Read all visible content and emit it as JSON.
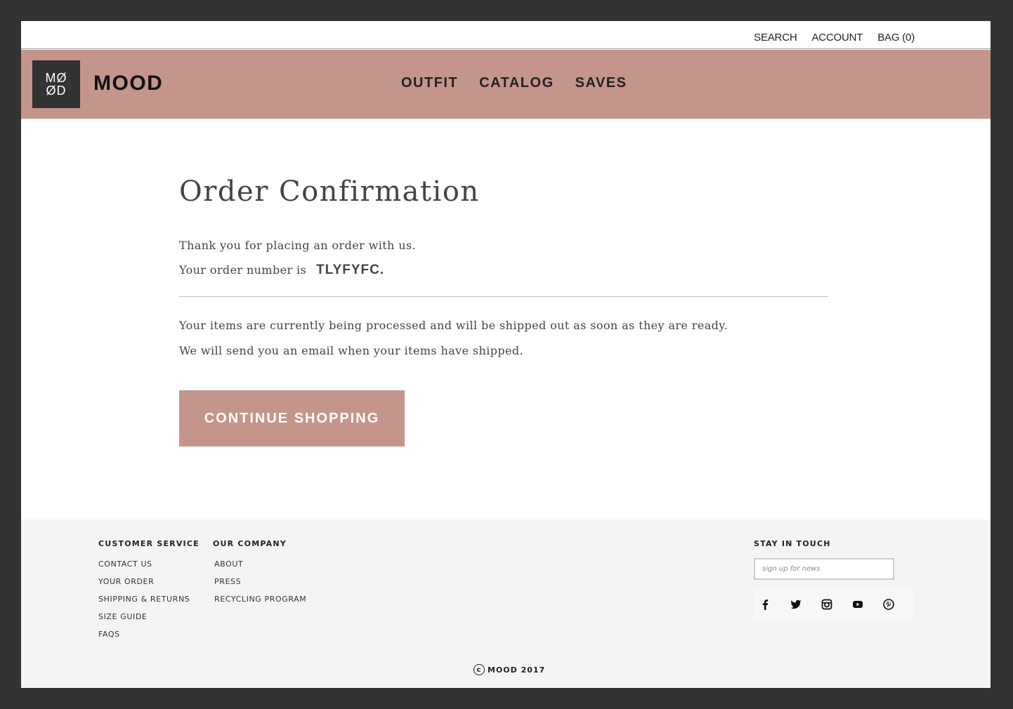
{
  "utility_nav": {
    "search": "SEARCH",
    "account": "ACCOUNT",
    "bag": "BAG (0)"
  },
  "brand": {
    "logo_line1": "MØ",
    "logo_line2": "ØD",
    "name": "MOOD"
  },
  "main_nav": {
    "outfit": "OUTFIT",
    "catalog": "CATALOG",
    "saves": "SAVES"
  },
  "confirmation": {
    "title": "Order Confirmation",
    "thanks": "Thank you for placing an order with us.",
    "order_number_label": "Your order number is",
    "order_number": "TLYFYFC.",
    "processing": "Your items are currently being processed and will be shipped out as soon as they are ready.",
    "email_notice": "We will send you an email when your items have shipped.",
    "continue_label": "CONTINUE SHOPPING"
  },
  "footer": {
    "customer_service": {
      "heading": "CUSTOMER SERVICE",
      "links": [
        "CONTACT US",
        "YOUR ORDER",
        "SHIPPING & RETURNS",
        "SIZE GUIDE",
        "FAQS"
      ]
    },
    "our_company": {
      "heading": "OUR COMPANY",
      "links": [
        "ABOUT",
        "PRESS",
        "RECYCLING PROGRAM"
      ]
    },
    "stay_in_touch": {
      "heading": "STAY IN TOUCH",
      "placeholder": "sign up for news",
      "social_icons": [
        "facebook-icon",
        "twitter-icon",
        "instagram-icon",
        "youtube-icon",
        "pinterest-icon"
      ]
    },
    "copyright_symbol": "c",
    "copyright": "MOOD 2017"
  },
  "colors": {
    "accent": "#c4958a",
    "frame": "#333333",
    "footer_bg": "#f5f3f3"
  }
}
